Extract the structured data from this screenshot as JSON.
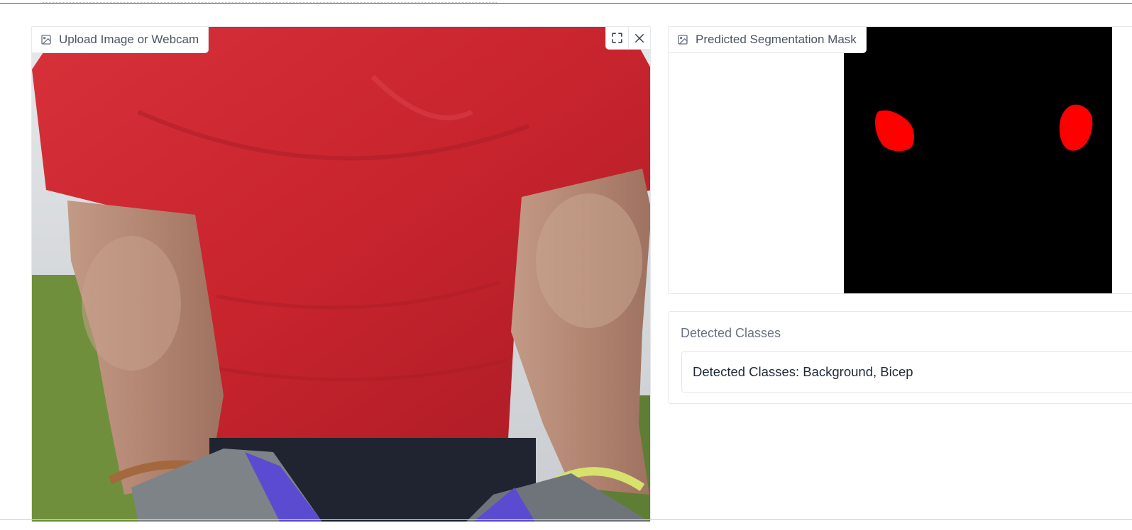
{
  "input": {
    "label": "Upload Image or Webcam",
    "label_icon": "image-icon",
    "controls": [
      {
        "name": "fullscreen",
        "icon": "fullscreen-icon"
      },
      {
        "name": "close",
        "icon": "close-icon"
      }
    ]
  },
  "output": {
    "label": "Predicted Segmentation Mask",
    "label_icon": "image-icon",
    "mask_colors": {
      "background": "#000000",
      "bicep": "#ff0000"
    }
  },
  "classes": {
    "title": "Detected Classes",
    "value": "Detected Classes: Background, Bicep"
  }
}
